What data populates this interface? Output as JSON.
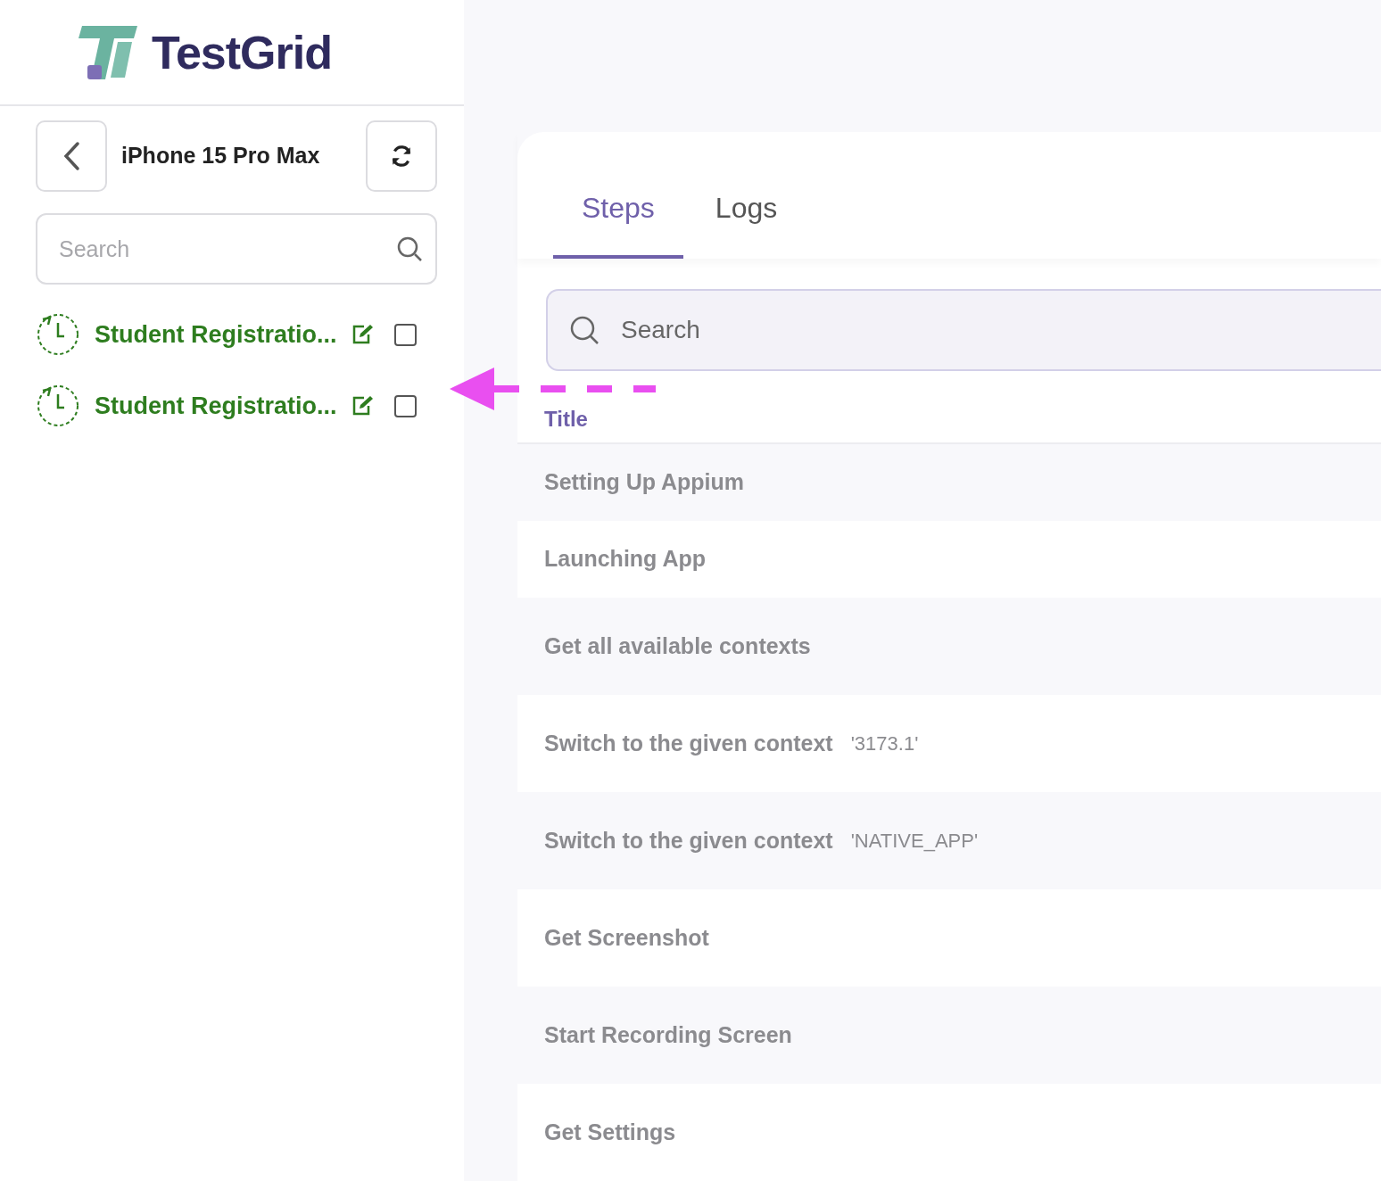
{
  "logo": {
    "text": "TestGrid"
  },
  "device": {
    "name": "iPhone 15 Pro Max"
  },
  "sidebar_search": {
    "placeholder": "Search"
  },
  "tests": [
    {
      "name": "Student Registratio...",
      "checked": false
    },
    {
      "name": "Student Registratio...",
      "checked": false
    }
  ],
  "tabs": [
    {
      "label": "Steps",
      "selected": true
    },
    {
      "label": "Logs",
      "selected": false
    }
  ],
  "steps_search": {
    "placeholder": "Search"
  },
  "table": {
    "columns": [
      "Title"
    ],
    "rows": [
      {
        "title": "Setting Up Appium"
      },
      {
        "title": "Launching App"
      },
      {
        "title": "Get all available contexts"
      },
      {
        "title": "Switch to the given context",
        "argument": "'3173.1'"
      },
      {
        "title": "Switch to the given context",
        "argument": "'NATIVE_APP'"
      },
      {
        "title": "Get Screenshot"
      },
      {
        "title": "Start Recording Screen"
      },
      {
        "title": "Get Settings"
      }
    ]
  }
}
